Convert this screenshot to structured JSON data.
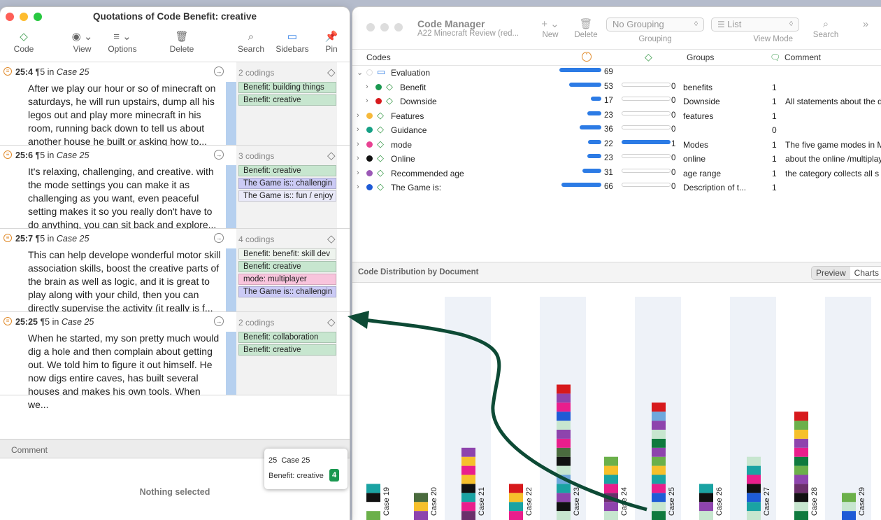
{
  "quotations_window": {
    "title": "Quotations of Code Benefit: creative",
    "toolbar": [
      {
        "label": "Code",
        "icon": "diamond-icon",
        "glyph": "◇"
      },
      {
        "label": "View",
        "icon": "eye-icon",
        "glyph": "◉ ⌄"
      },
      {
        "label": "Options",
        "icon": "list-options-icon",
        "glyph": "≡ ⌄"
      },
      {
        "label": "Delete",
        "icon": "trash-icon",
        "glyph": "🗑"
      },
      {
        "label": "Search",
        "icon": "search-icon",
        "glyph": "⌕"
      },
      {
        "label": "Sidebars",
        "icon": "sidebar-icon",
        "glyph": "▭"
      },
      {
        "label": "Pin",
        "icon": "pin-icon",
        "glyph": "📌"
      }
    ],
    "quotations": [
      {
        "id": "25:4",
        "para": "¶5 in",
        "case": "Case 25",
        "codings": "2 codings",
        "text": "After we play our hour or so of minecraft on saturdays, he will run upstairs, dump all his legos out and play more minecraft in his room, running back down to tell us about another house he built or asking how to...",
        "chips": [
          {
            "label": "Benefit: building things",
            "color": "#c7e6cf"
          },
          {
            "label": "Benefit: creative",
            "color": "#c7e6cf"
          }
        ]
      },
      {
        "id": "25:6",
        "para": "¶5 in",
        "case": "Case 25",
        "codings": "3 codings",
        "text": "It's relaxing, challenging, and creative. with the mode settings you can make it as challenging as you want, even peaceful setting makes it so you really don't have to do anything, you can sit back and explore...",
        "chips": [
          {
            "label": "Benefit: creative",
            "color": "#c7e6cf"
          },
          {
            "label": "The Game is:: challengin",
            "color": "#cbcaf5"
          },
          {
            "label": "The Game is:: fun / enjoy",
            "color": "#e9e9f8"
          }
        ]
      },
      {
        "id": "25:7",
        "para": "¶5 in",
        "case": "Case 25",
        "codings": "4 codings",
        "text": "This can help develope wonderful motor skill association skills, boost the creative parts of the brain as well as logic, and it is great to play along with your child, then you can directly supervise the activity (it really is f...",
        "chips": [
          {
            "label": "Benefit: benefit: skill dev",
            "color": "#eef4ee"
          },
          {
            "label": "Benefit: creative",
            "color": "#c7e6cf"
          },
          {
            "label": "mode: multiplayer",
            "color": "#f8c4dc"
          },
          {
            "label": "The Game is:: challengin",
            "color": "#cbcaf5"
          }
        ]
      },
      {
        "id": "25:25",
        "para": "¶5 in",
        "case": "Case 25",
        "codings": "2 codings",
        "text": "When he started, my son pretty much would dig a hole and then complain about getting out. We told him to figure it out himself. He now digs entire caves, has built several houses and makes his own tools. When we...",
        "chips": [
          {
            "label": "Benefit: collaboration",
            "color": "#c7e6cf"
          },
          {
            "label": "Benefit: creative",
            "color": "#c7e6cf"
          }
        ]
      }
    ],
    "comment_label": "Comment",
    "nothing_selected": "Nothing selected"
  },
  "code_manager": {
    "title": "Code Manager",
    "subtitle": "A22 Minecraft Review (red...",
    "toolbar": {
      "new": "New",
      "delete": "Delete",
      "grouping": "Grouping",
      "grouping_value": "No Grouping",
      "view_mode": "View Mode",
      "view_mode_value": "List",
      "search": "Search"
    },
    "columns": {
      "codes": "Codes",
      "groups": "Groups",
      "comment": "Comment"
    },
    "rows": [
      {
        "name": "Evaluation",
        "color": "",
        "folder": true,
        "expanded": true,
        "grounded": 69,
        "density": null,
        "groups": "",
        "comment_count": "",
        "comment": "",
        "indent": 0
      },
      {
        "name": "Benefit",
        "color": "#1a9850",
        "folder": false,
        "grounded": 53,
        "density": 0,
        "groups": "benefits",
        "comment_count": "1",
        "comment": "",
        "indent": 1
      },
      {
        "name": "Downside",
        "color": "#d7191c",
        "folder": false,
        "grounded": 17,
        "density": 0,
        "groups": "Downside",
        "comment_count": "1",
        "comment": "All statements about the d",
        "indent": 1
      },
      {
        "name": "Features",
        "color": "#f6b93b",
        "folder": false,
        "grounded": 23,
        "density": 0,
        "groups": "features",
        "comment_count": "1",
        "comment": "",
        "indent": 0
      },
      {
        "name": "Guidance",
        "color": "#16a085",
        "folder": false,
        "grounded": 36,
        "density": 0,
        "groups": "",
        "comment_count": "0",
        "comment": "",
        "indent": 0
      },
      {
        "name": "mode",
        "color": "#e84393",
        "folder": false,
        "grounded": 22,
        "density": 1,
        "groups": "Modes",
        "comment_count": "1",
        "comment": "The five game modes in M",
        "indent": 0
      },
      {
        "name": "Online",
        "color": "#111111",
        "folder": false,
        "grounded": 23,
        "density": 0,
        "groups": "online",
        "comment_count": "1",
        "comment": "about the online /multiplay",
        "indent": 0
      },
      {
        "name": "Recommended age",
        "color": "#9b59b6",
        "folder": false,
        "grounded": 31,
        "density": 0,
        "groups": "age range",
        "comment_count": "1",
        "comment": "the category collects all s",
        "indent": 0
      },
      {
        "name": "The Game is:",
        "color": "#1e5bd6",
        "folder": false,
        "grounded": 66,
        "density": 0,
        "groups": "Description of t...",
        "comment_count": "1",
        "comment": "",
        "indent": 0
      }
    ],
    "section_title": "Code Distribution by Document",
    "preview_label": "Preview",
    "charts_label": "Charts",
    "tooltip": {
      "doc": "25",
      "case": "Case 25",
      "code": "Benefit: creative",
      "count": "4"
    }
  },
  "chart_data": {
    "type": "bar",
    "stacked": true,
    "title": "",
    "categories": [
      "Case 19",
      "Case 20",
      "Case 21",
      "Case 22",
      "Case 23",
      "Case 24",
      "Case 25",
      "Case 26",
      "Case 27",
      "Case 28",
      "Case 29"
    ],
    "segment_colors": {
      "Case 19": [
        "#6bb04a",
        "#ffffff",
        "#111111",
        "#1aa3a3"
      ],
      "Case 20": [
        "#8e44ad",
        "#f6c02b",
        "#4a6b3e"
      ],
      "Case 21": [
        "#6b2f6b",
        "#e91e8c",
        "#1aa3a3",
        "#111111",
        "#f6c02b",
        "#e91e8c",
        "#f6c02b",
        "#8e44ad"
      ],
      "Case 22": [
        "#e91e8c",
        "#1aa3a3",
        "#f6c02b",
        "#d7191c"
      ],
      "Case 23": [
        "#c7e6cf",
        "#111111",
        "#8e44ad",
        "#1aa3a3",
        "#6fa8dc",
        "#c7e6cf",
        "#111111",
        "#4a6b3e",
        "#e91e8c",
        "#8e44ad",
        "#c7e6cf",
        "#1e5bd6",
        "#e91e8c",
        "#8e44ad",
        "#d7191c"
      ],
      "Case 24": [
        "#c7e6cf",
        "#8e44ad",
        "#6b2f6b",
        "#e91e8c",
        "#1aa3a3",
        "#f6c02b",
        "#6bb04a"
      ],
      "Case 25": [
        "#0f7a3e",
        "#c7e6cf",
        "#1e5bd6",
        "#e91e8c",
        "#1aa3a3",
        "#f6c02b",
        "#6bb04a",
        "#8e44ad",
        "#0f7a3e",
        "#c7e6cf",
        "#8e44ad",
        "#6fa8dc",
        "#d7191c"
      ],
      "Case 26": [
        "#c7e6cf",
        "#8e44ad",
        "#111111",
        "#1aa3a3"
      ],
      "Case 27": [
        "#c7e6cf",
        "#1aa3a3",
        "#1e5bd6",
        "#111111",
        "#e91e8c",
        "#1aa3a3",
        "#c7e6cf"
      ],
      "Case 28": [
        "#0f7a3e",
        "#c7e6cf",
        "#111111",
        "#6b2f6b",
        "#8e44ad",
        "#6bb04a",
        "#0f7a3e",
        "#e91e8c",
        "#8e44ad",
        "#f6c02b",
        "#6bb04a",
        "#d7191c"
      ],
      "Case 29": [
        "#1e5bd6",
        "#c7e6cf",
        "#6bb04a"
      ]
    }
  }
}
